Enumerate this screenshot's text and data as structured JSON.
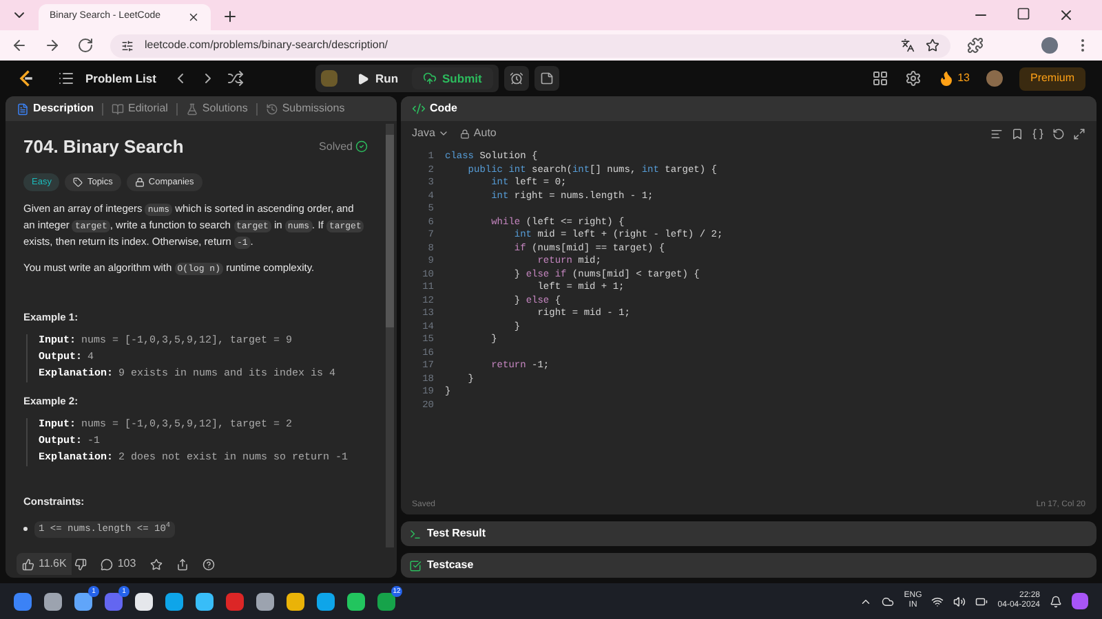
{
  "browser": {
    "tab_title": "Binary Search - LeetCode",
    "url": "leetcode.com/problems/binary-search/description/"
  },
  "nav": {
    "problem_list": "Problem List",
    "run": "Run",
    "submit": "Submit",
    "streak": "13",
    "premium": "Premium"
  },
  "left_tabs": [
    {
      "label": "Description",
      "selected": true
    },
    {
      "label": "Editorial",
      "selected": false
    },
    {
      "label": "Solutions",
      "selected": false
    },
    {
      "label": "Submissions",
      "selected": false
    }
  ],
  "problem": {
    "title": "704. Binary Search",
    "status": "Solved",
    "difficulty": "Easy",
    "tags": [
      "Topics",
      "Companies"
    ],
    "paragraphs": [
      [
        {
          "text": "Given an array of integers ",
          "kind": "text"
        },
        {
          "text": "nums",
          "kind": "code"
        },
        {
          "text": " which is sorted in ascending order, and an integer ",
          "kind": "text"
        },
        {
          "text": "target",
          "kind": "code"
        },
        {
          "text": ", write a function to search ",
          "kind": "text"
        },
        {
          "text": "target",
          "kind": "code"
        },
        {
          "text": " in ",
          "kind": "text"
        },
        {
          "text": "nums",
          "kind": "code"
        },
        {
          "text": ". If ",
          "kind": "text"
        },
        {
          "text": "target",
          "kind": "code"
        },
        {
          "text": " exists, then return its index. Otherwise, return ",
          "kind": "text"
        },
        {
          "text": "-1",
          "kind": "code"
        },
        {
          "text": ".",
          "kind": "text"
        }
      ],
      [
        {
          "text": "You must write an algorithm with ",
          "kind": "text"
        },
        {
          "text": "O(log n)",
          "kind": "code"
        },
        {
          "text": " runtime complexity.",
          "kind": "text"
        }
      ]
    ],
    "examples": [
      {
        "title": "Example 1:",
        "lines": [
          {
            "label": "Input:",
            "value": "nums = [-1,0,3,5,9,12], target = 9"
          },
          {
            "label": "Output:",
            "value": "4"
          },
          {
            "label": "Explanation:",
            "value": "9 exists in nums and its index is 4"
          }
        ]
      },
      {
        "title": "Example 2:",
        "lines": [
          {
            "label": "Input:",
            "value": "nums = [-1,0,3,5,9,12], target = 2"
          },
          {
            "label": "Output:",
            "value": "-1"
          },
          {
            "label": "Explanation:",
            "value": "2 does not exist in nums so return -1"
          }
        ]
      }
    ],
    "constraints_title": "Constraints:",
    "constraints": [
      "1 <= nums.length <= 10$^{4}$"
    ]
  },
  "footer": {
    "likes": "11.6K",
    "comments": "103"
  },
  "code": {
    "title": "Code",
    "language": "Java",
    "mode": "Auto",
    "status": "Saved",
    "cursor": "Ln 17, Col 20",
    "lines": [
      {
        "no": "1",
        "segments": [
          {
            "text": "class",
            "kind": "keyword"
          },
          {
            "text": " Solution {",
            "kind": "plain"
          }
        ]
      },
      {
        "no": "2",
        "segments": [
          {
            "text": "    public ",
            "kind": "keyword"
          },
          {
            "text": "int",
            "kind": "keyword"
          },
          {
            "text": " search(",
            "kind": "plain"
          },
          {
            "text": "int",
            "kind": "keyword"
          },
          {
            "text": "[] nums, ",
            "kind": "plain"
          },
          {
            "text": "int",
            "kind": "keyword"
          },
          {
            "text": " target) {",
            "kind": "plain"
          }
        ]
      },
      {
        "no": "3",
        "segments": [
          {
            "text": "        int",
            "kind": "keyword"
          },
          {
            "text": " left = 0;",
            "kind": "plain"
          }
        ]
      },
      {
        "no": "4",
        "segments": [
          {
            "text": "        int",
            "kind": "keyword"
          },
          {
            "text": " right = nums.length - 1;",
            "kind": "plain"
          }
        ]
      },
      {
        "no": "5"
      },
      {
        "no": "6",
        "segments": [
          {
            "text": "        while",
            "kind": "control"
          },
          {
            "text": " (left <= right) {",
            "kind": "plain"
          }
        ]
      },
      {
        "no": "7",
        "segments": [
          {
            "text": "            int",
            "kind": "keyword"
          },
          {
            "text": " mid = left + (right - left) / 2;",
            "kind": "plain"
          }
        ]
      },
      {
        "no": "8",
        "segments": [
          {
            "text": "            if",
            "kind": "control"
          },
          {
            "text": " (nums[mid] == target) {",
            "kind": "plain"
          }
        ]
      },
      {
        "no": "9",
        "segments": [
          {
            "text": "                return",
            "kind": "control"
          },
          {
            "text": " mid;",
            "kind": "plain"
          }
        ]
      },
      {
        "no": "10",
        "segments": [
          {
            "text": "            } ",
            "kind": "plain"
          },
          {
            "text": "else if",
            "kind": "control"
          },
          {
            "text": " (nums[mid] < target) {",
            "kind": "plain"
          }
        ]
      },
      {
        "no": "11",
        "segments": [
          {
            "text": "                left = mid + 1;",
            "kind": "plain"
          }
        ]
      },
      {
        "no": "12",
        "segments": [
          {
            "text": "            } ",
            "kind": "plain"
          },
          {
            "text": "else",
            "kind": "control"
          },
          {
            "text": " {",
            "kind": "plain"
          }
        ]
      },
      {
        "no": "13",
        "segments": [
          {
            "text": "                right = mid - 1;",
            "kind": "plain"
          }
        ]
      },
      {
        "no": "14",
        "segments": [
          {
            "text": "            }",
            "kind": "plain"
          }
        ]
      },
      {
        "no": "15",
        "segments": [
          {
            "text": "        }",
            "kind": "plain"
          }
        ]
      },
      {
        "no": "16"
      },
      {
        "no": "17",
        "segments": [
          {
            "text": "        return",
            "kind": "control"
          },
          {
            "text": " -1;",
            "kind": "plain"
          }
        ]
      },
      {
        "no": "18",
        "segments": [
          {
            "text": "    }",
            "kind": "plain"
          }
        ]
      },
      {
        "no": "19",
        "segments": [
          {
            "text": "}",
            "kind": "plain"
          }
        ]
      },
      {
        "no": "20"
      }
    ]
  },
  "panels": [
    {
      "title": "Test Result",
      "kind": "terminal"
    },
    {
      "title": "Testcase",
      "kind": "check"
    }
  ],
  "taskbar": {
    "apps": [
      {
        "color": "#3b82f6"
      },
      {
        "color": "#9ca3af"
      },
      {
        "color": "#60a5fa",
        "badge": "1"
      },
      {
        "color": "#6366f1",
        "badge": "1"
      },
      {
        "color": "#e5e7eb"
      },
      {
        "color": "#0ea5e9"
      },
      {
        "color": "#38bdf8"
      },
      {
        "color": "#dc2626"
      },
      {
        "color": "#9ca3af"
      },
      {
        "color": "#eab308"
      },
      {
        "color": "#0ea5e9"
      },
      {
        "color": "#22c55e"
      },
      {
        "color": "#16a34a",
        "badge": "12"
      }
    ],
    "language": "ENG",
    "region": "IN",
    "time": "22:28",
    "date": "04-04-2024"
  }
}
